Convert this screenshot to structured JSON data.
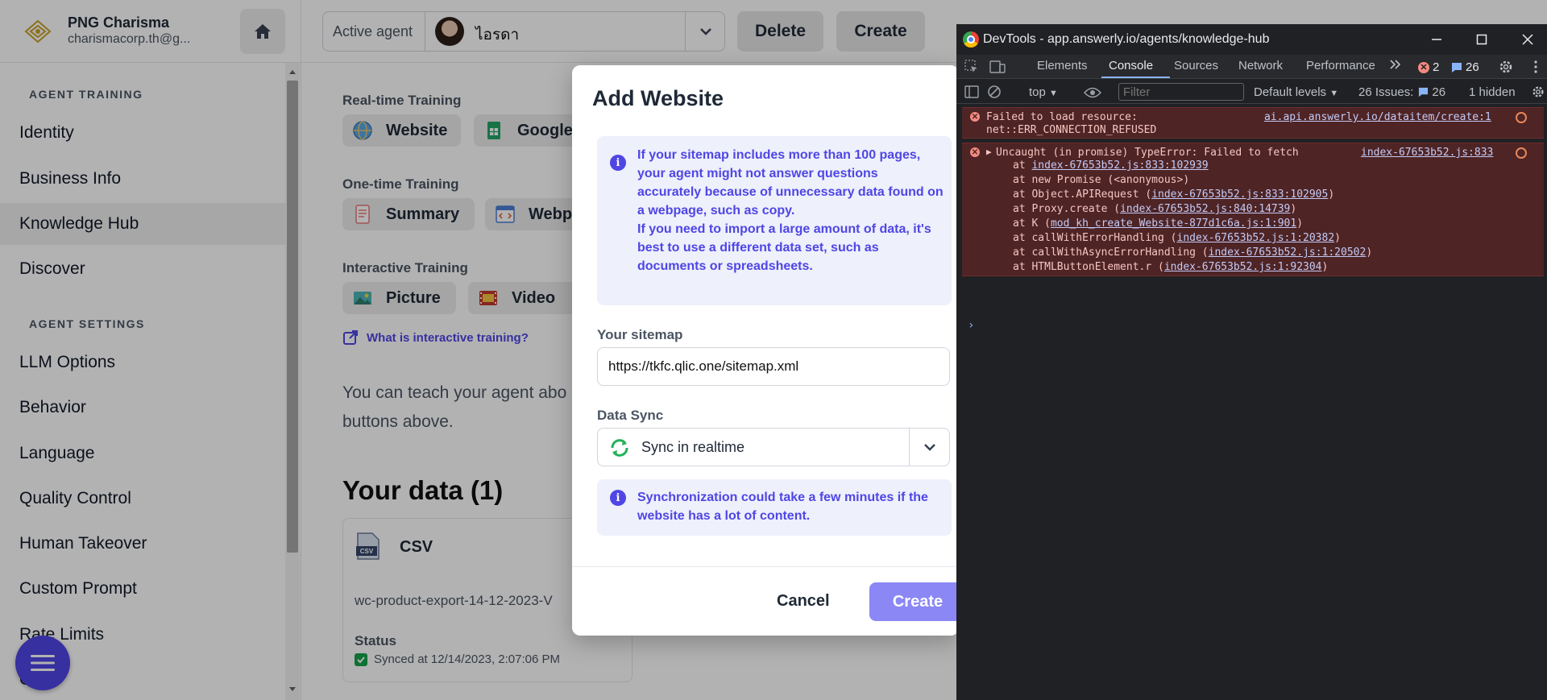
{
  "brand": {
    "name": "PNG Charisma",
    "email": "charismacorp.th@g..."
  },
  "sidebar": {
    "section_training": "AGENT TRAINING",
    "section_settings": "AGENT SETTINGS",
    "items": [
      {
        "label": "Identity"
      },
      {
        "label": "Business Info"
      },
      {
        "label": "Knowledge Hub"
      },
      {
        "label": "Discover"
      },
      {
        "label": "LLM Options"
      },
      {
        "label": "Behavior"
      },
      {
        "label": "Language"
      },
      {
        "label": "Quality Control"
      },
      {
        "label": "Human Takeover"
      },
      {
        "label": "Custom Prompt"
      },
      {
        "label": "Rate Limits"
      },
      {
        "label": "Other"
      }
    ]
  },
  "topbar": {
    "agent_label": "Active agent",
    "agent_name": "ไอรดา",
    "delete_label": "Delete",
    "create_label": "Create"
  },
  "training": {
    "realtime_title": "Real-time Training",
    "realtime_items": [
      "Website",
      "Google S"
    ],
    "onetime_title": "One-time Training",
    "onetime_items": [
      "Summary",
      "Webpa"
    ],
    "interactive_title": "Interactive Training",
    "interactive_items": [
      "Picture",
      "Video"
    ],
    "what_link": "What is interactive training?",
    "teach_text": "You can teach your agent abo buttons above."
  },
  "data_section": {
    "title": "Your data (1)",
    "card_type": "CSV",
    "file_name": "wc-product-export-14-12-2023-V",
    "status_label": "Status",
    "status_value": "Synced at 12/14/2023, 2:07:06 PM"
  },
  "modal": {
    "title": "Add Website",
    "info1_p1": "If your sitemap includes more than 100 pages, your agent might not answer questions accurately because of unnecessary data found on a webpage, such as copy.",
    "info1_p2": "If you need to import a large amount of data, it's best to use a different data set, such as documents or spreadsheets.",
    "sitemap_label": "Your sitemap",
    "sitemap_value": "https://tkfc.qlic.one/sitemap.xml",
    "sync_label": "Data Sync",
    "sync_value": "Sync in realtime",
    "info2": "Synchronization could take a few minutes if the website has a lot of content.",
    "cancel": "Cancel",
    "create": "Create"
  },
  "devtools": {
    "title": "DevTools - app.answerly.io/agents/knowledge-hub",
    "tabs": [
      "Elements",
      "Console",
      "Sources",
      "Network",
      "Performance"
    ],
    "error_count": "2",
    "issue_count": "26",
    "context": "top",
    "filter_placeholder": "Filter",
    "levels": "Default levels",
    "issues_label": "26 Issues:",
    "issues_count": "26",
    "hidden": "1 hidden",
    "errors": [
      {
        "lines": [
          "Failed to load resource:",
          "net::ERR_CONNECTION_REFUSED"
        ],
        "source": "ai.api.answerly.io/dataitem/create:1"
      },
      {
        "head": "Uncaught (in promise) TypeError: Failed to fetch",
        "source": "index-67653b52.js:833",
        "stack": [
          {
            "prefix": "at ",
            "link": "index-67653b52.js:833:102939",
            "suffix": ""
          },
          {
            "prefix": "at new Promise (<anonymous>)",
            "link": "",
            "suffix": ""
          },
          {
            "prefix": "at Object.APIRequest (",
            "link": "index-67653b52.js:833:102905",
            "suffix": ")"
          },
          {
            "prefix": "at Proxy.create (",
            "link": "index-67653b52.js:840:14739",
            "suffix": ")"
          },
          {
            "prefix": "at K (",
            "link": "mod_kh_create_Website-877d1c6a.js:1:901",
            "suffix": ")"
          },
          {
            "prefix": "at callWithErrorHandling (",
            "link": "index-67653b52.js:1:20382",
            "suffix": ")"
          },
          {
            "prefix": "at callWithAsyncErrorHandling (",
            "link": "index-67653b52.js:1:20502",
            "suffix": ")"
          },
          {
            "prefix": "at HTMLButtonElement.r (",
            "link": "index-67653b52.js:1:92304",
            "suffix": ")"
          }
        ]
      }
    ]
  },
  "colors": {
    "accent": "#4f46e5",
    "create_btn": "#8b87f5",
    "devtools_bg": "#202124",
    "error_bg": "#4e2425"
  }
}
